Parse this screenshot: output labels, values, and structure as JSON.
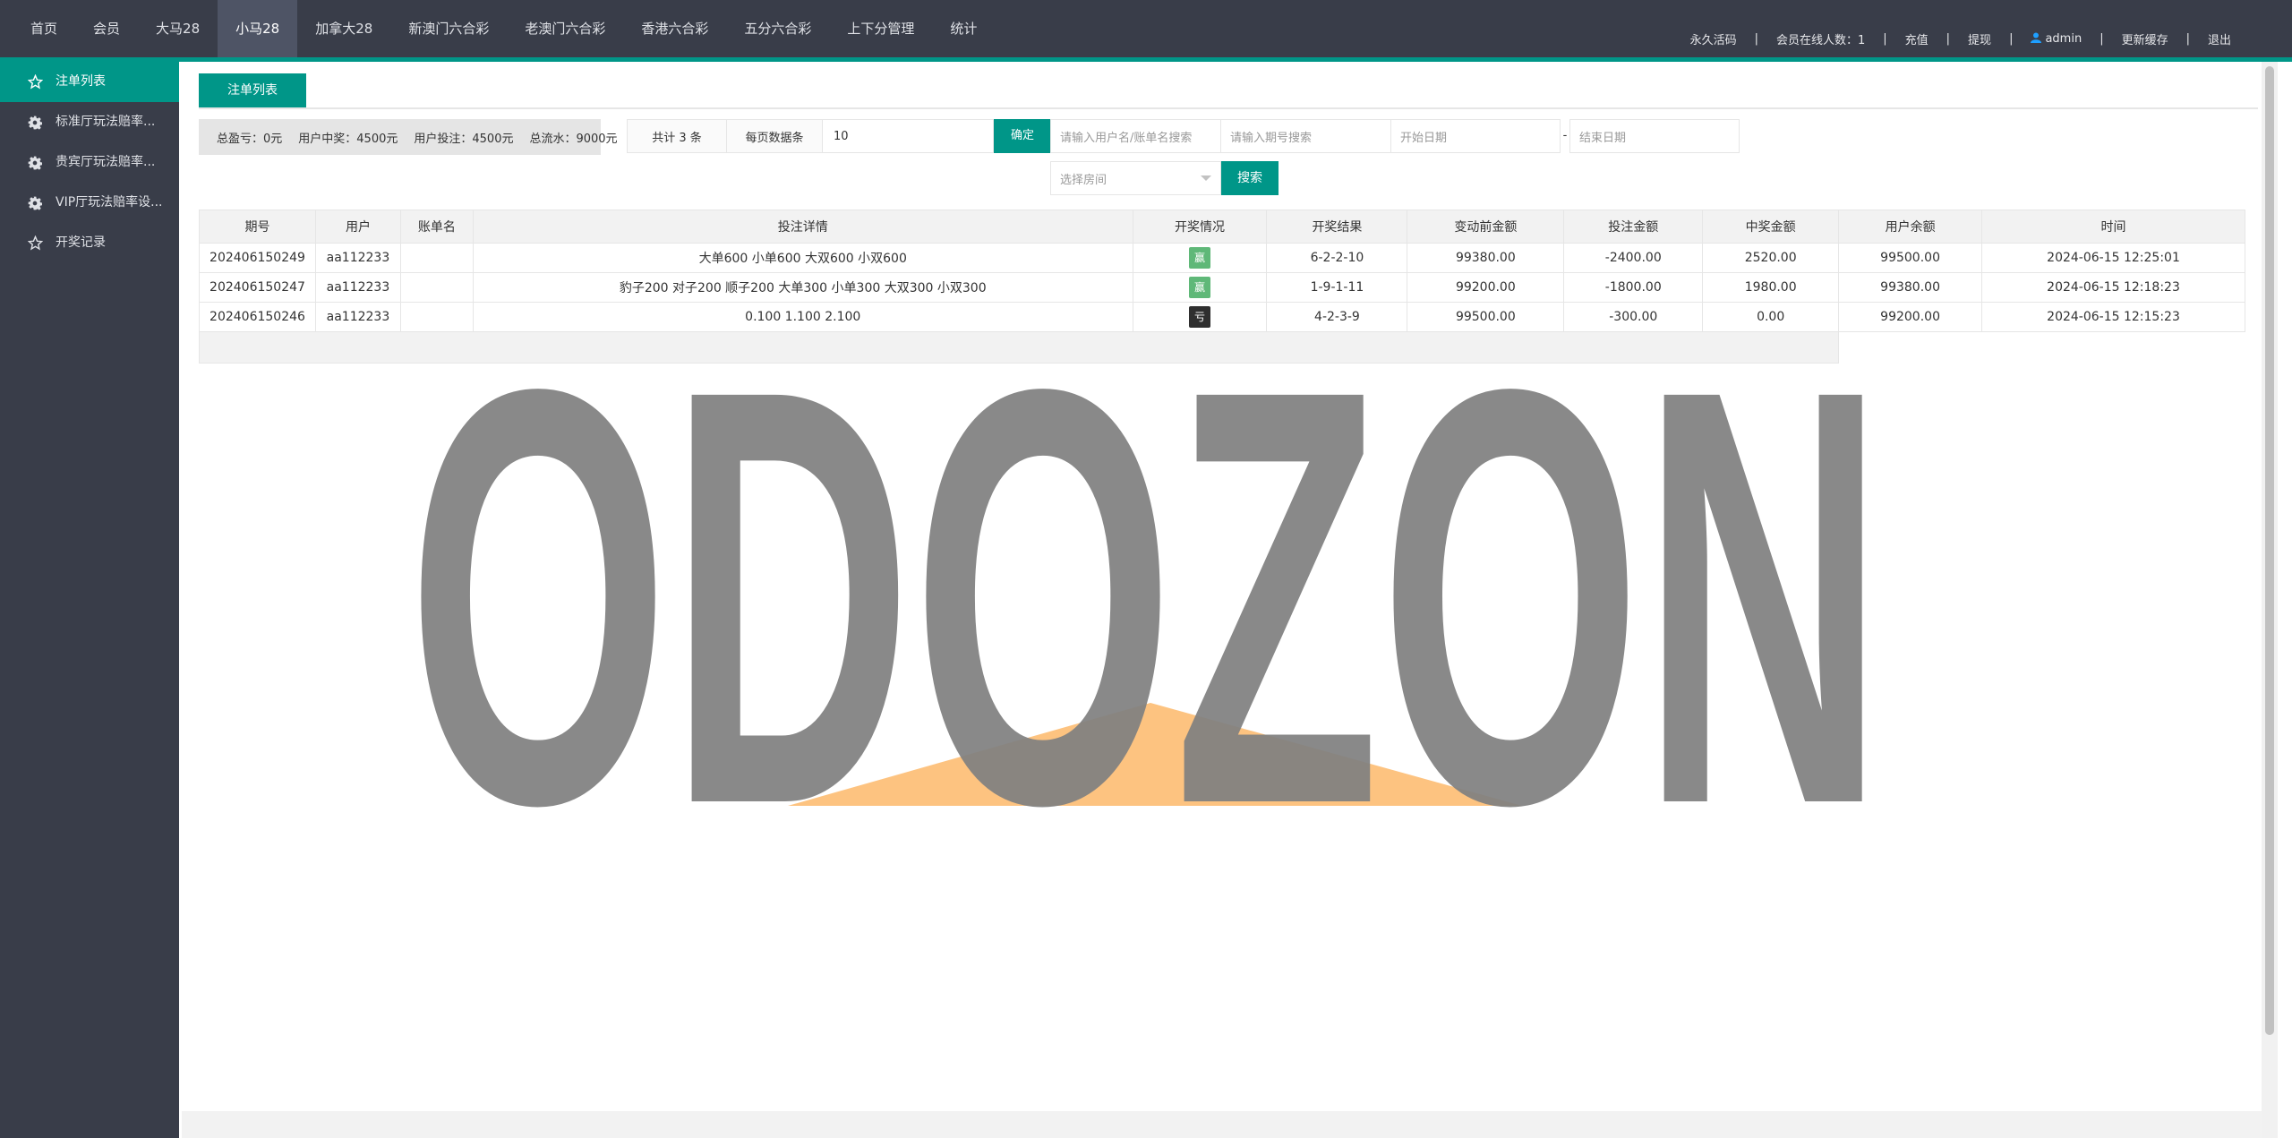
{
  "topnav": {
    "items": [
      {
        "label": "首页",
        "active": false
      },
      {
        "label": "会员",
        "active": false
      },
      {
        "label": "大马28",
        "active": false
      },
      {
        "label": "小马28",
        "active": true
      },
      {
        "label": "加拿大28",
        "active": false
      },
      {
        "label": "新澳门六合彩",
        "active": false
      },
      {
        "label": "老澳门六合彩",
        "active": false
      },
      {
        "label": "香港六合彩",
        "active": false
      },
      {
        "label": "五分六合彩",
        "active": false
      },
      {
        "label": "上下分管理",
        "active": false
      },
      {
        "label": "统计",
        "active": false
      }
    ],
    "right": {
      "activation": "永久活码",
      "online": "会员在线人数：1",
      "recharge": "充值",
      "withdraw": "提现",
      "user": "admin",
      "refresh_cache": "更新缓存",
      "logout": "退出",
      "separator": "|"
    }
  },
  "sidebar": {
    "items": [
      {
        "label": "注单列表",
        "icon": "star-icon",
        "active": true
      },
      {
        "label": "标准厅玩法赔率...",
        "icon": "gear-icon",
        "active": false
      },
      {
        "label": "贵宾厅玩法赔率...",
        "icon": "gear-icon",
        "active": false
      },
      {
        "label": "VIP厅玩法赔率设...",
        "icon": "gear-icon",
        "active": false
      },
      {
        "label": "开奖记录",
        "icon": "star-icon",
        "active": false
      }
    ]
  },
  "page": {
    "tab_title": "注单列表"
  },
  "stats": {
    "total_profit": "总盈亏：0元",
    "user_win": "用户中奖：4500元",
    "user_bet": "用户投注：4500元",
    "total_flow": "总流水：9000元"
  },
  "filters": {
    "total": "共计 3 条",
    "per_page_label": "每页数据条",
    "per_page_value": "10",
    "confirm": "确定",
    "search_user_placeholder": "请输入用户名/账单名搜索",
    "search_period_placeholder": "请输入期号搜索",
    "start_date_placeholder": "开始日期",
    "dash": "-",
    "end_date_placeholder": "结束日期",
    "room_placeholder": "选择房间",
    "search": "搜索"
  },
  "table": {
    "headers": [
      "期号",
      "用户",
      "账单名",
      "投注详情",
      "开奖情况",
      "开奖结果",
      "变动前金额",
      "投注金额",
      "中奖金额",
      "用户余额",
      "时间"
    ],
    "rows": [
      {
        "period": "202406150249",
        "user": "aa112233",
        "bill": "",
        "detail": "大单600 小单600 大双600 小双600",
        "status": "赢",
        "status_type": "win",
        "result": "6-2-2-10",
        "before": "99380.00",
        "bet": "-2400.00",
        "win": "2520.00",
        "balance": "99500.00",
        "time": "2024-06-15 12:25:01"
      },
      {
        "period": "202406150247",
        "user": "aa112233",
        "bill": "",
        "detail": "豹子200 对子200 顺子200 大单300 小单300 大双300 小双300",
        "status": "赢",
        "status_type": "win",
        "result": "1-9-1-11",
        "before": "99200.00",
        "bet": "-1800.00",
        "win": "1980.00",
        "balance": "99380.00",
        "time": "2024-06-15 12:18:23"
      },
      {
        "period": "202406150246",
        "user": "aa112233",
        "bill": "",
        "detail": "0.100 1.100 2.100",
        "status": "亏",
        "status_type": "lose",
        "result": "4-2-3-9",
        "before": "99500.00",
        "bet": "-300.00",
        "win": "0.00",
        "balance": "99200.00",
        "time": "2024-06-15 12:15:23"
      }
    ]
  },
  "watermark": {
    "text": "ODOZON",
    "text_color": "#808080",
    "roof_color": "#fdb96a"
  },
  "colors": {
    "accent": "#009688",
    "nav_bg": "#393d49",
    "win": "#5fb878",
    "lose": "#2f2f2f"
  }
}
